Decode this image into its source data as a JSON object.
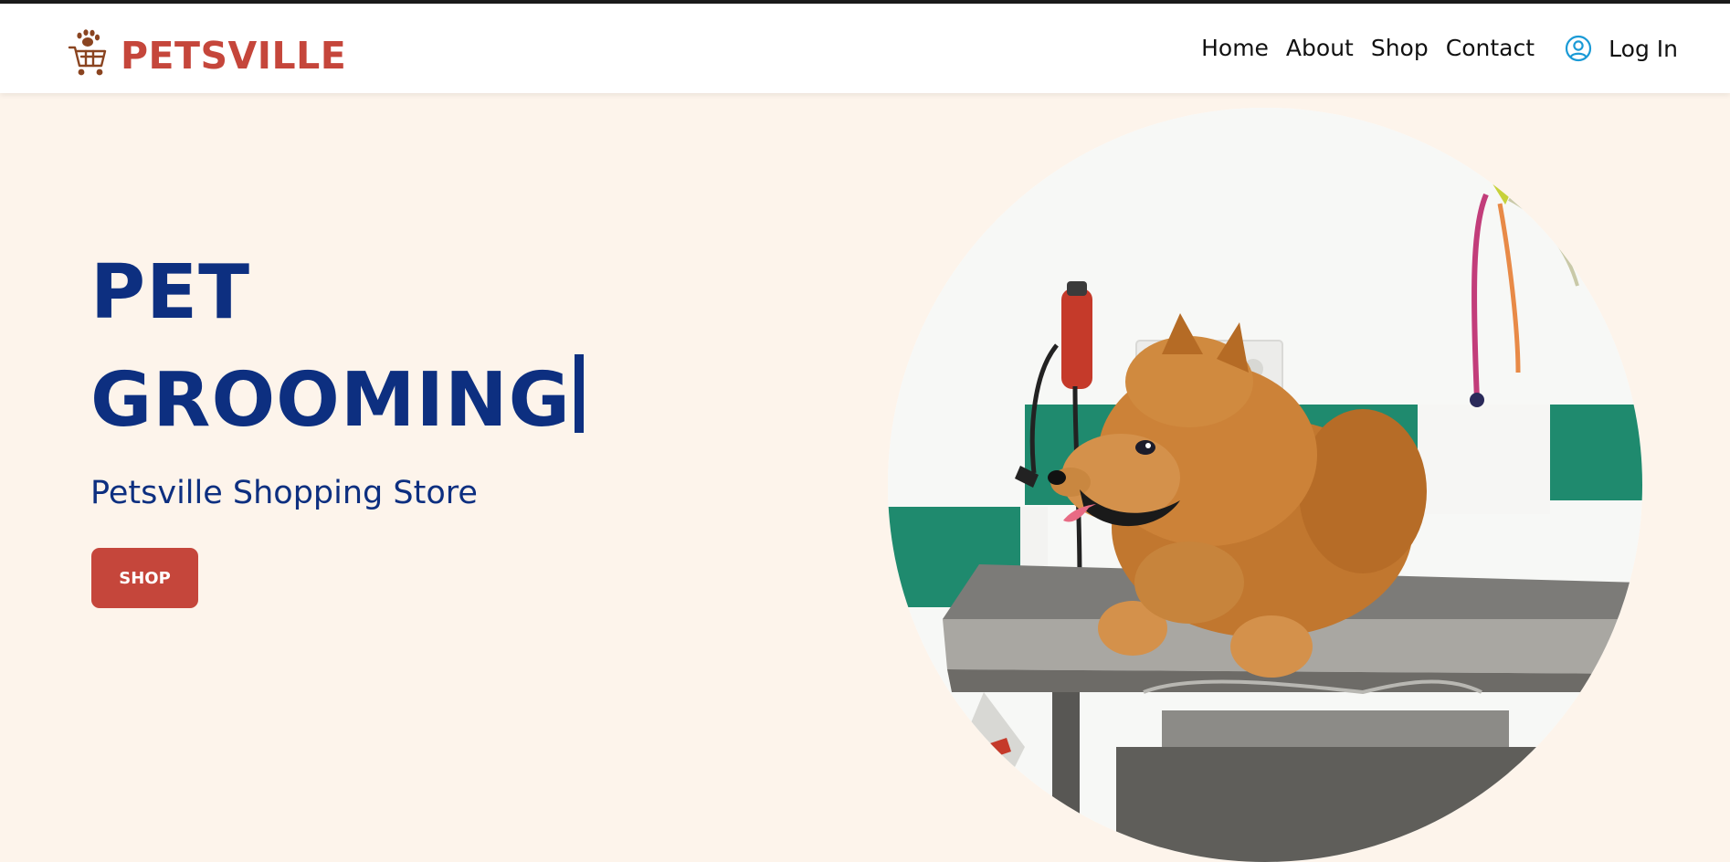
{
  "brand": {
    "name": "PETSVILLE",
    "logo_icon": "paw-cart-icon",
    "color": "#c5463b"
  },
  "nav": {
    "links": [
      "Home",
      "About",
      "Shop",
      "Contact"
    ],
    "login_label": "Log In",
    "login_icon": "user-circle-icon",
    "login_icon_color": "#1a9ad6"
  },
  "hero": {
    "title_lines": [
      "PET",
      "GROOMING"
    ],
    "subtitle": "Petsville Shopping Store",
    "button_label": "SHOP",
    "title_color": "#0d2f80",
    "button_color": "#c5463b",
    "background_color": "#fdf4eb",
    "image": "pomeranian-dog-on-grooming-table-photo"
  }
}
